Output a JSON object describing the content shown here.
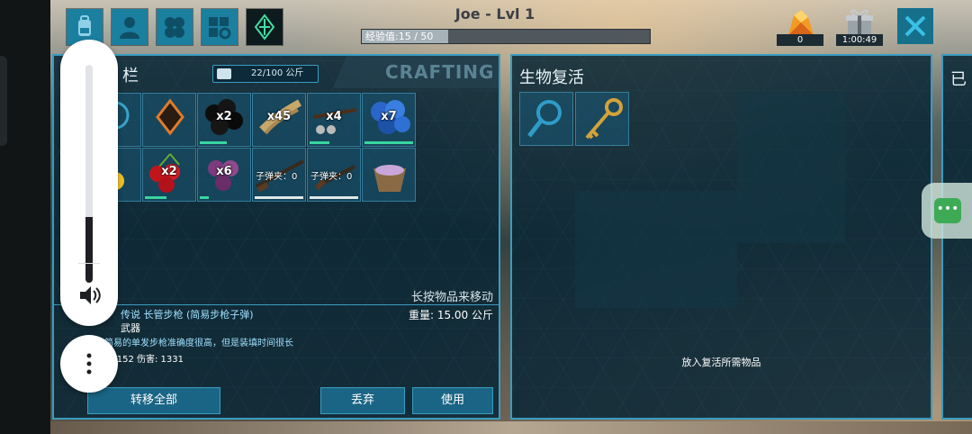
{
  "header": {
    "player_name": "Joe - Lvl 1",
    "xp_text": "经验值:15 / 50",
    "xp_fraction": 0.3,
    "resource_count": "0",
    "timer": "1:00:49"
  },
  "top_icons": [
    "backpack-icon",
    "character-icon",
    "tribe-icon",
    "map-icon",
    "element-icon"
  ],
  "inventory": {
    "title": "物品栏",
    "title_visible": "栏",
    "weight": "22/100 公斤",
    "crafting_tab": "CRAFTING",
    "slots": [
      {
        "name": "magnifier",
        "qty": ""
      },
      {
        "name": "hide",
        "qty": ""
      },
      {
        "name": "narcoberry",
        "qty": "x2"
      },
      {
        "name": "fiber",
        "qty": "x45"
      },
      {
        "name": "crossbow",
        "qty": "x4"
      },
      {
        "name": "azulberry",
        "qty": "x7"
      },
      {
        "name": "amarberry",
        "qty": ""
      },
      {
        "name": "mejoberry",
        "qty": "x2"
      },
      {
        "name": "tintoberry",
        "qty": "x6"
      },
      {
        "name": "simple-rifle",
        "qty": "",
        "ammo": "子弹夹：0"
      },
      {
        "name": "simple-pistol",
        "qty": "",
        "ammo": "子弹夹：0"
      },
      {
        "name": "mortar",
        "qty": ""
      }
    ],
    "hint": "长按物品来移动",
    "item_name": "传说 长管步枪 (简易步枪子弹)",
    "item_weight": "重量: 15.00 公斤",
    "item_type": "武器",
    "item_desc": "比仿简易的单发步枪准确度很高，但是装填时间很长",
    "item_stats": "2/152 伤害: 1331",
    "buttons": {
      "transfer_all": "转移全部",
      "drop": "丢弃",
      "use": "使用"
    }
  },
  "revive": {
    "title": "生物复活",
    "empty_hint": "放入复活所需物品"
  },
  "third_panel": {
    "title": "已"
  },
  "overlay": {
    "volume_level": 0.3,
    "handle_label": "•••"
  },
  "colors": {
    "panel_border": "#3a9cc0",
    "slot_bg": "#1b5a78",
    "accent_blue": "#1b7fa0",
    "durability": "#39d6a0"
  }
}
